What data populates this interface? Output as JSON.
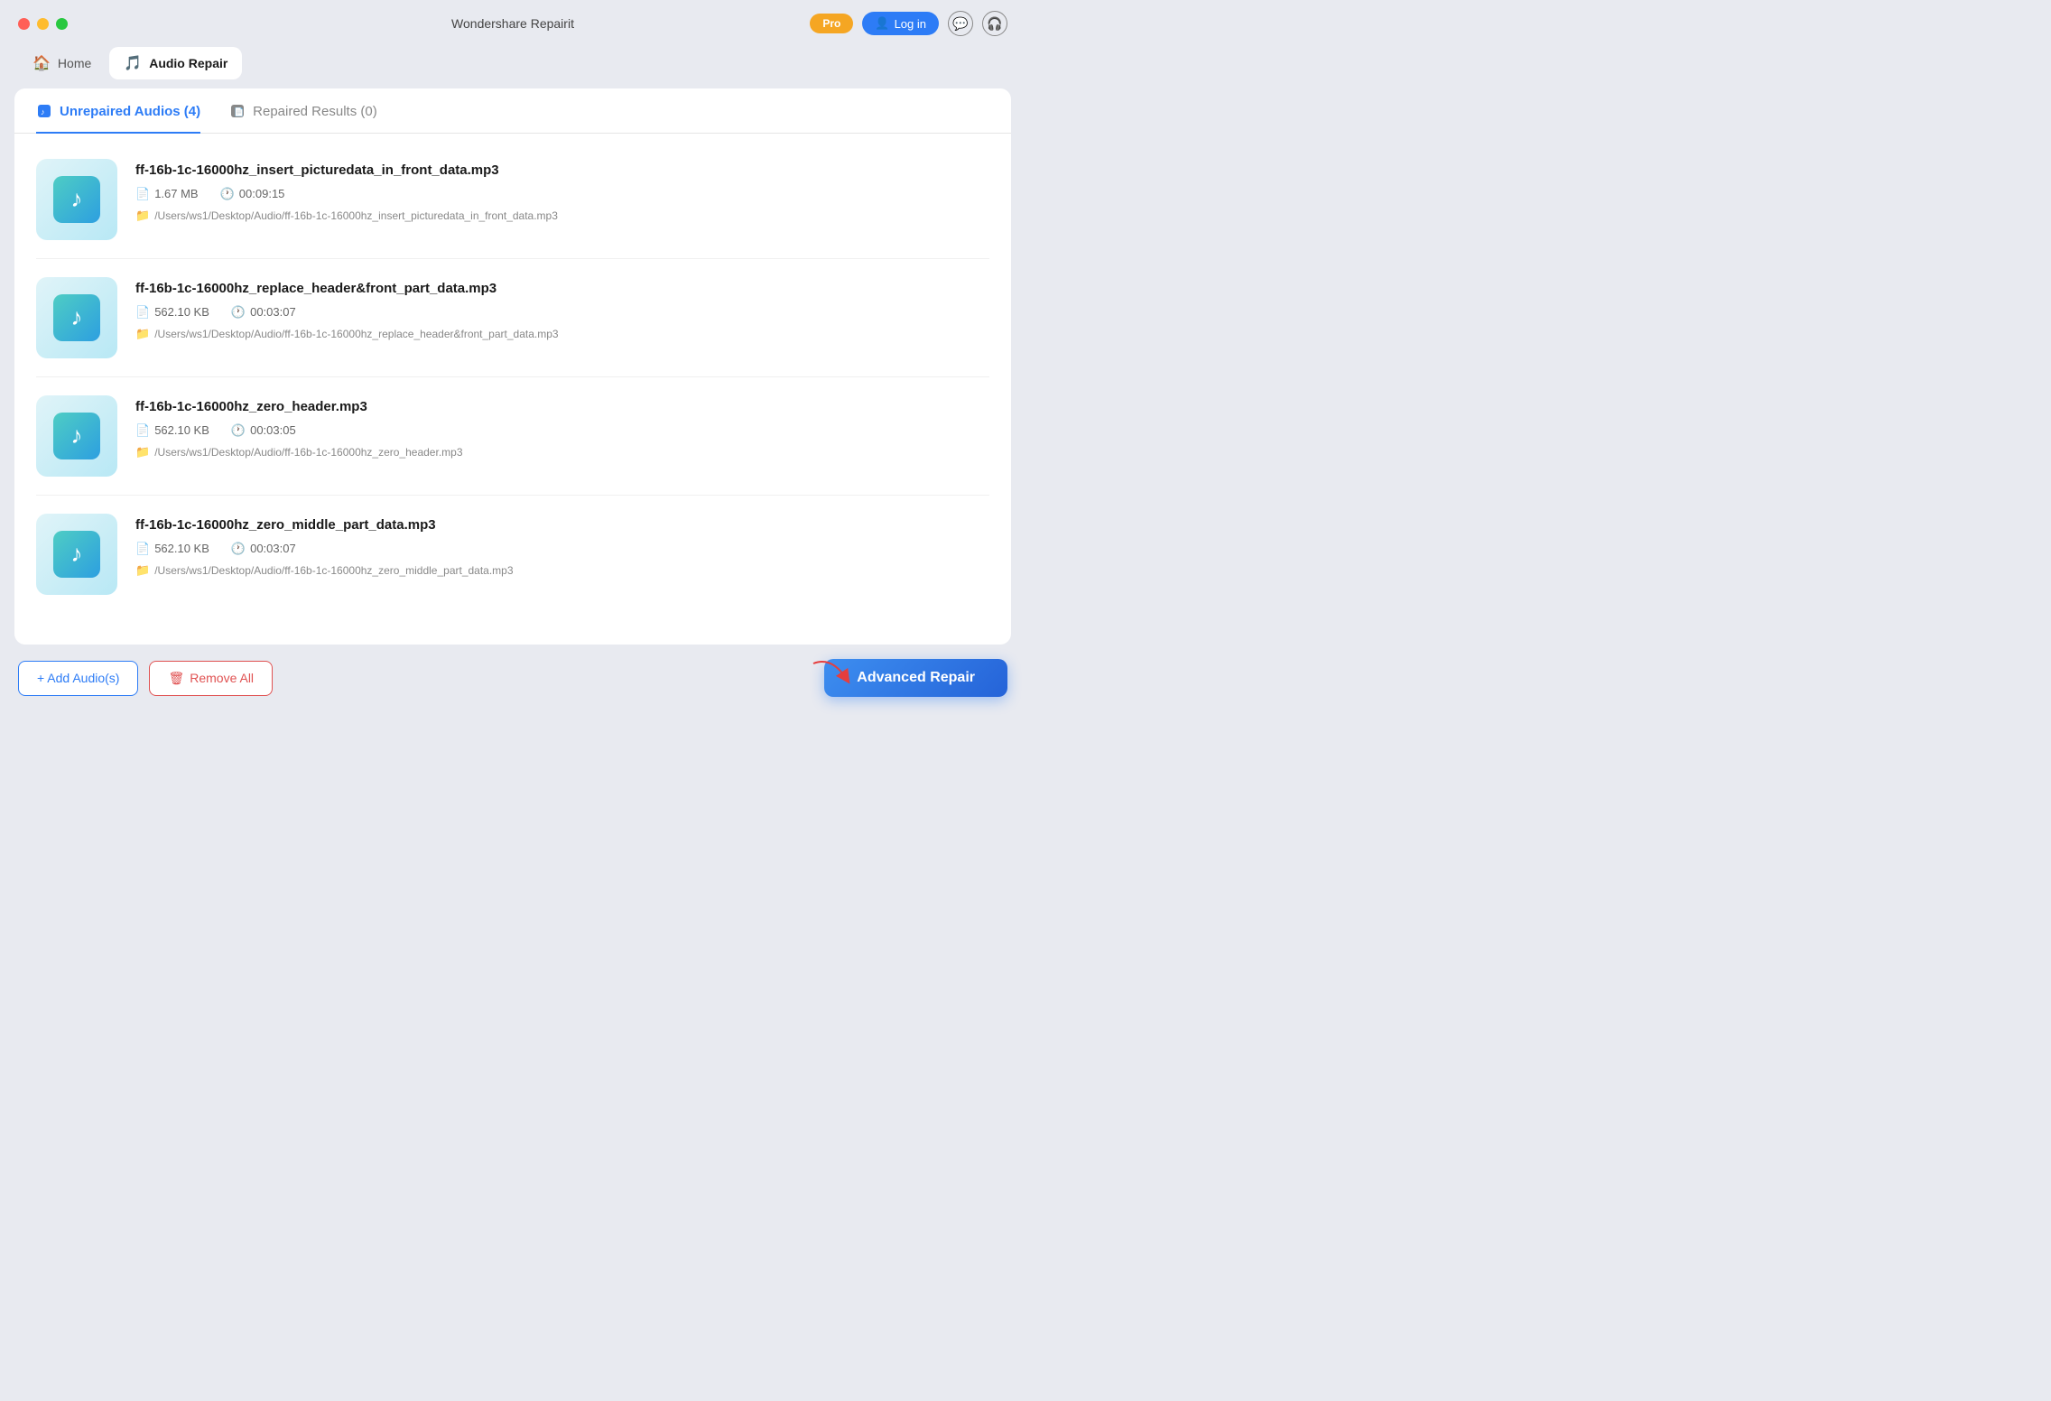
{
  "app": {
    "title": "Wondershare Repairit",
    "pro_label": "Pro",
    "login_label": "Log in"
  },
  "nav": {
    "home_label": "Home",
    "audio_repair_label": "Audio Repair"
  },
  "tabs": {
    "unrepaired_label": "Unrepaired Audios (4)",
    "repaired_label": "Repaired Results (0)"
  },
  "files": [
    {
      "name": "ff-16b-1c-16000hz_insert_picturedata_in_front_data.mp3",
      "size": "1.67 MB",
      "duration": "00:09:15",
      "path": "/Users/ws1/Desktop/Audio/ff-16b-1c-16000hz_insert_picturedata_in_front_data.mp3"
    },
    {
      "name": "ff-16b-1c-16000hz_replace_header&front_part_data.mp3",
      "size": "562.10 KB",
      "duration": "00:03:07",
      "path": "/Users/ws1/Desktop/Audio/ff-16b-1c-16000hz_replace_header&front_part_data.mp3"
    },
    {
      "name": "ff-16b-1c-16000hz_zero_header.mp3",
      "size": "562.10 KB",
      "duration": "00:03:05",
      "path": "/Users/ws1/Desktop/Audio/ff-16b-1c-16000hz_zero_header.mp3"
    },
    {
      "name": "ff-16b-1c-16000hz_zero_middle_part_data.mp3",
      "size": "562.10 KB",
      "duration": "00:03:07",
      "path": "/Users/ws1/Desktop/Audio/ff-16b-1c-16000hz_zero_middle_part_data.mp3"
    }
  ],
  "buttons": {
    "add_label": "+ Add Audio(s)",
    "remove_label": "Remove All",
    "repair_label": "Advanced Repair"
  }
}
